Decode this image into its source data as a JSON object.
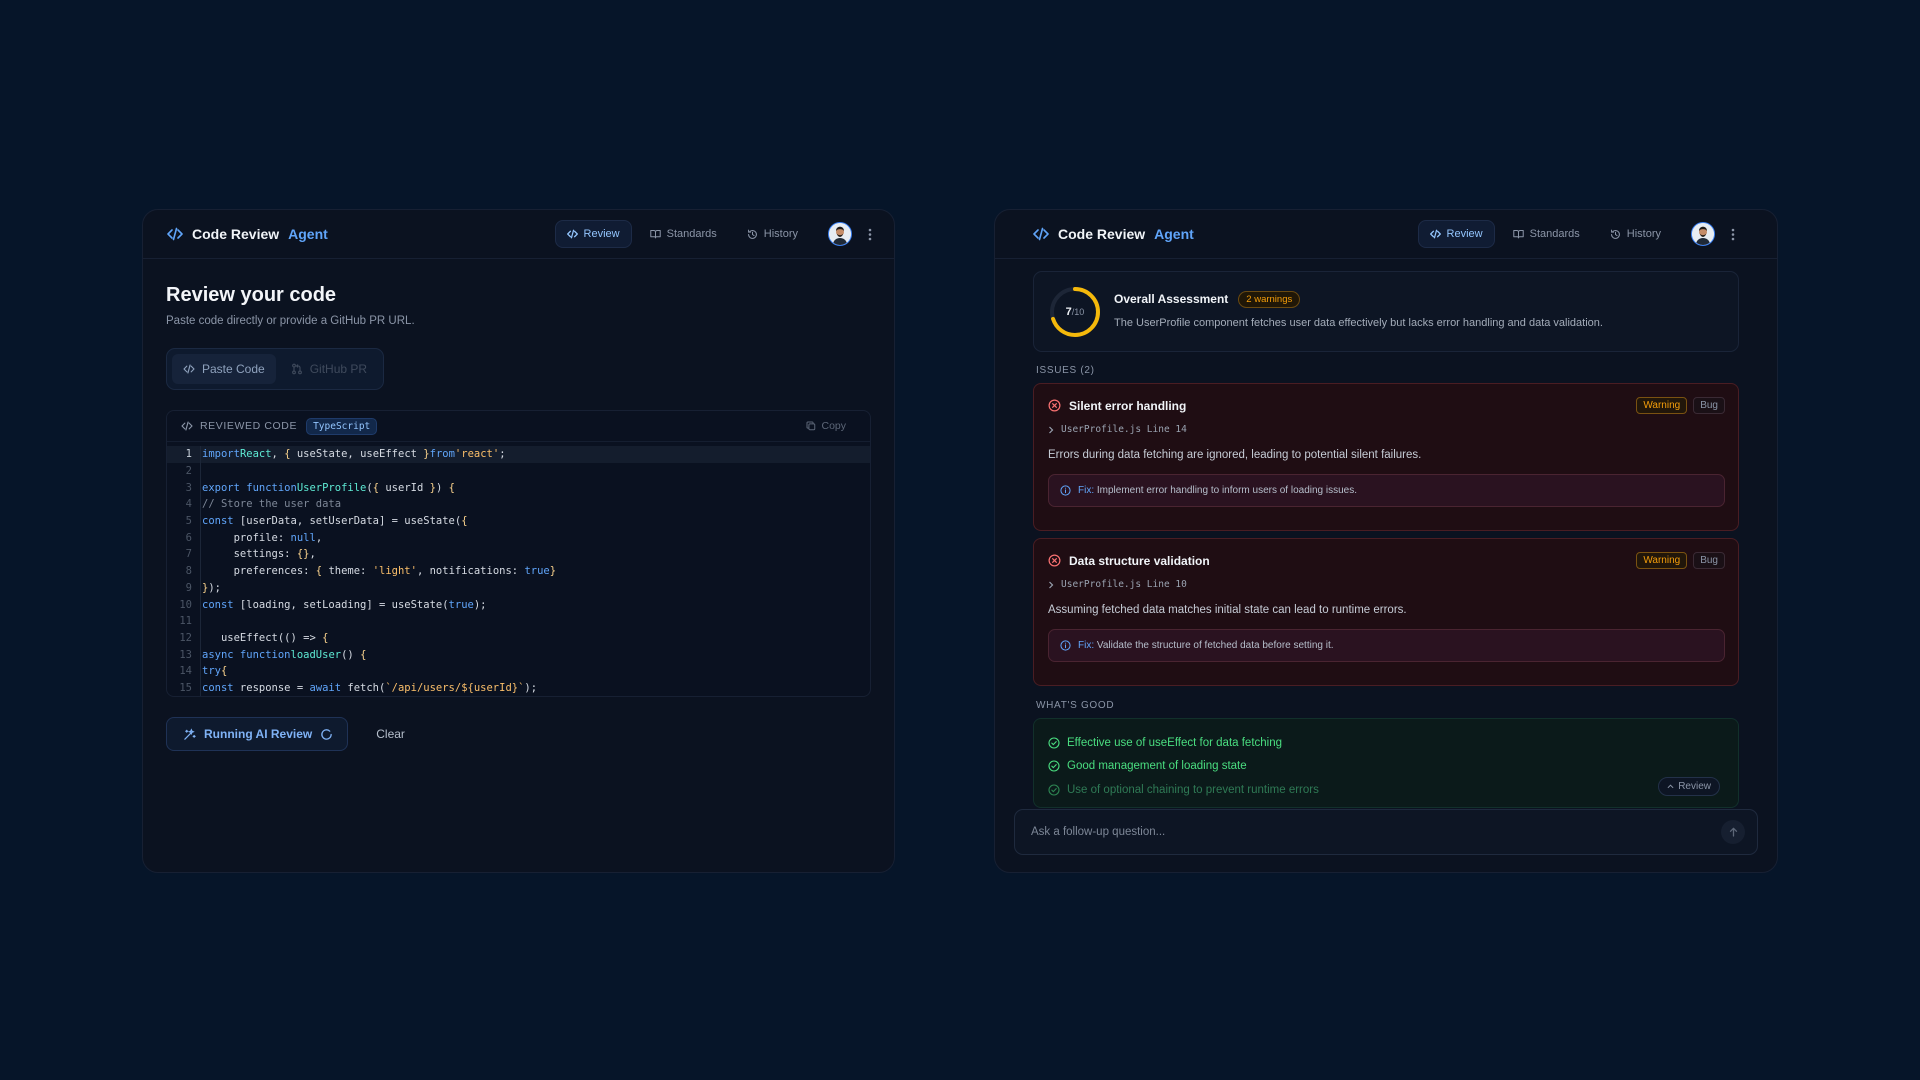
{
  "app": {
    "brand_main": "Code Review",
    "brand_accent": "Agent",
    "nav": [
      "Review",
      "Standards",
      "History"
    ]
  },
  "left": {
    "title": "Review your code",
    "subtitle": "Paste code directly or provide a GitHub PR URL.",
    "modes": [
      "Paste Code",
      "GitHub PR"
    ],
    "code_header": "REVIEWED CODE",
    "language": "TypeScript",
    "copy_label": "Copy",
    "line_numbers": [
      "1",
      "2",
      "3",
      "4",
      "5",
      "6",
      "7",
      "8",
      "9",
      "10",
      "11",
      "12",
      "13",
      "14",
      "15"
    ],
    "run_label": "Running AI Review",
    "clear_label": "Clear"
  },
  "right": {
    "score_value": "7",
    "score_total": "/10",
    "score_fraction": 0.7,
    "assessment_title": "Overall Assessment",
    "warnings_chip": "2 warnings",
    "assessment_text": "The UserProfile component fetches user data effectively but lacks error handling and data validation.",
    "issues_label": "ISSUES (2)",
    "issues": [
      {
        "title": "Silent error handling",
        "severity": "Warning",
        "type": "Bug",
        "location": "UserProfile.js Line 14",
        "description": "Errors during data fetching are ignored, leading to potential silent failures.",
        "fix_label": "Fix:",
        "fix_text": "Implement error handling to inform users of loading issues."
      },
      {
        "title": "Data structure validation",
        "severity": "Warning",
        "type": "Bug",
        "location": "UserProfile.js Line 10",
        "description": "Assuming fetched data matches initial state can lead to runtime errors.",
        "fix_label": "Fix:",
        "fix_text": "Validate the structure of fetched data before setting it."
      }
    ],
    "good_label": "WHAT'S GOOD",
    "good_items": [
      "Effective use of useEffect for data fetching",
      "Good management of loading state",
      "Use of optional chaining to prevent runtime errors"
    ],
    "review_pill": "Review",
    "ask_placeholder": "Ask a follow-up question..."
  },
  "colors": {
    "background": "#061529",
    "accent": "#60a5fa",
    "warning": "#f59e0b",
    "success": "#4ade80",
    "score_ring": "#f5b90b"
  }
}
